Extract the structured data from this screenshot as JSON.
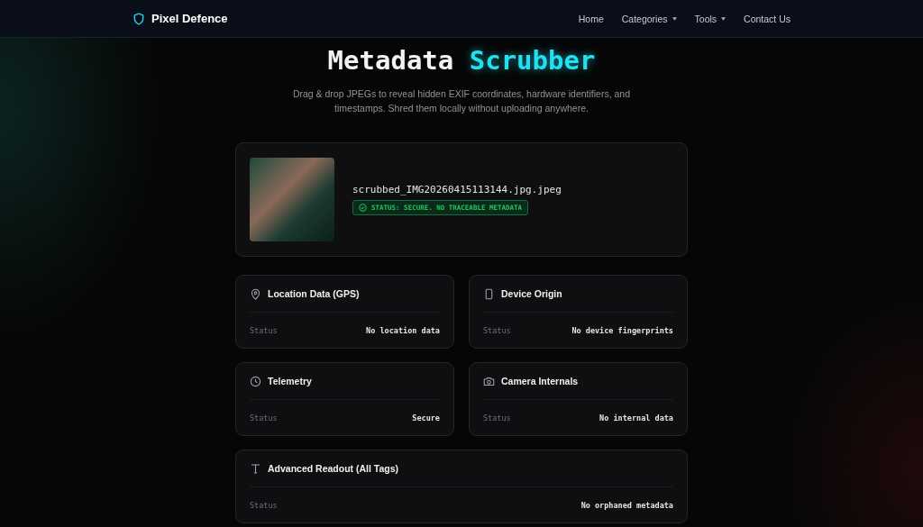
{
  "brand": "Pixel Defence",
  "nav": [
    {
      "label": "Home",
      "dropdown": false
    },
    {
      "label": "Categories",
      "dropdown": true
    },
    {
      "label": "Tools",
      "dropdown": true
    },
    {
      "label": "Contact Us",
      "dropdown": false
    }
  ],
  "title": {
    "text": "Metadata",
    "highlight": "Scrubber"
  },
  "subtitle": "Drag & drop JPEGs to reveal hidden EXIF coordinates, hardware identifiers, and timestamps. Shred them locally without uploading anywhere.",
  "file": {
    "name": "scrubbed_IMG20260415113144.jpg.jpeg",
    "status": "STATUS: SECURE. NO TRACEABLE METADATA"
  },
  "cards": [
    {
      "kind": "location",
      "title": "Location Data (GPS)",
      "label": "Status",
      "value": "No location data",
      "wide": false
    },
    {
      "kind": "device",
      "title": "Device Origin",
      "label": "Status",
      "value": "No device fingerprints",
      "wide": false
    },
    {
      "kind": "time",
      "title": "Telemetry",
      "label": "Status",
      "value": "Secure",
      "wide": false
    },
    {
      "kind": "camera",
      "title": "Camera Internals",
      "label": "Status",
      "value": "No internal data",
      "wide": false
    },
    {
      "kind": "text",
      "title": "Advanced Readout (All Tags)",
      "label": "Status",
      "value": "No orphaned metadata",
      "wide": true
    }
  ]
}
